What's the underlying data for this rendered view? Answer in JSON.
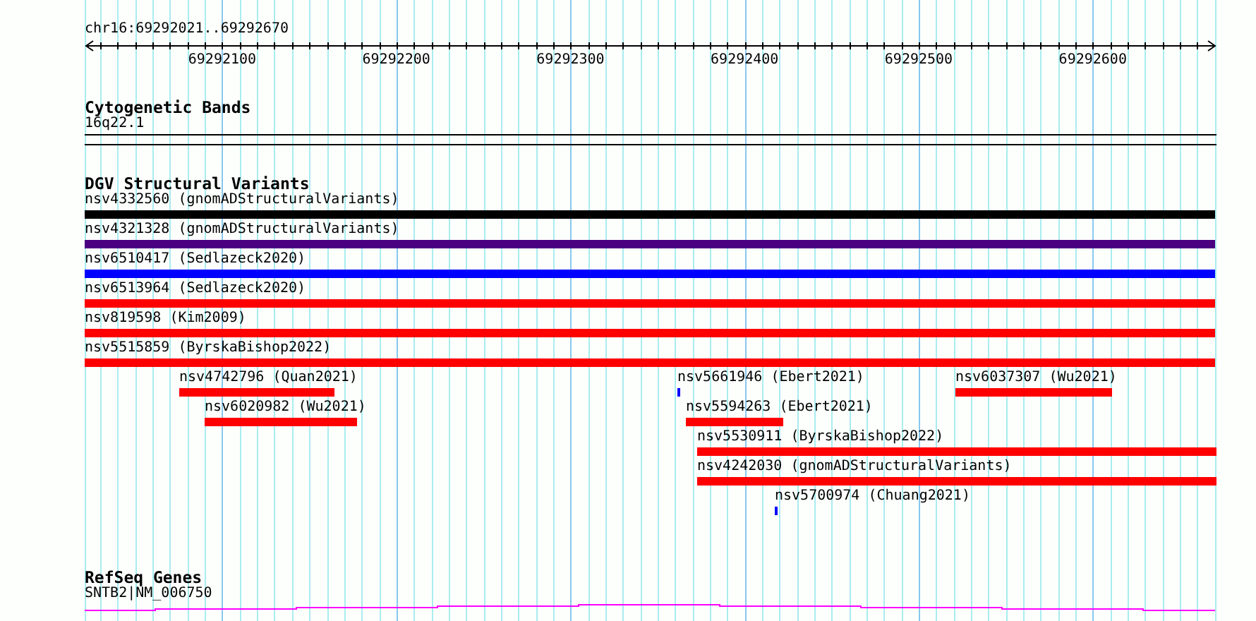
{
  "ruler": {
    "position": "chr16:69292021..69292670",
    "ticks": [
      "69292100",
      "69292200",
      "69292300",
      "69292400",
      "69292500",
      "69292600"
    ]
  },
  "tracks": [
    {
      "kind": "cytoband",
      "title": "Cytogenetic Bands",
      "items": [
        {
          "label": "16q22.1"
        }
      ]
    },
    {
      "kind": "variants",
      "title": "DGV Structural Variants",
      "items": [
        {
          "label": "nsv4332560 (gnomADStructuralVariants)",
          "color": "#000000"
        },
        {
          "label": "nsv4321328 (gnomADStructuralVariants)",
          "color": "#4b0082"
        },
        {
          "label": "nsv6510417 (Sedlazeck2020)",
          "color": "#0000ff"
        },
        {
          "label": "nsv6513964 (Sedlazeck2020)",
          "color": "#ff0000"
        },
        {
          "label": "nsv819598 (Kim2009)",
          "color": "#ff0000"
        },
        {
          "label": "nsv5515859 (ByrskaBishop2022)",
          "color": "#ff0000"
        },
        {
          "label": "nsv4742796 (Quan2021)",
          "color": "#ff0000"
        },
        {
          "label": "nsv5661946 (Ebert2021)",
          "color": "#0000ff"
        },
        {
          "label": "nsv6037307 (Wu2021)",
          "color": "#ff0000"
        },
        {
          "label": "nsv6020982 (Wu2021)",
          "color": "#ff0000"
        },
        {
          "label": "nsv5594263 (Ebert2021)",
          "color": "#ff0000"
        },
        {
          "label": "nsv5530911 (ByrskaBishop2022)",
          "color": "#ff0000"
        },
        {
          "label": "nsv4242030 (gnomADStructuralVariants)",
          "color": "#ff0000"
        },
        {
          "label": "nsv5700974 (Chuang2021)",
          "color": "#0000ff"
        }
      ]
    },
    {
      "kind": "gene",
      "title": "RefSeq Genes",
      "items": [
        {
          "label": "SNTB2|NM_006750"
        }
      ]
    }
  ]
}
